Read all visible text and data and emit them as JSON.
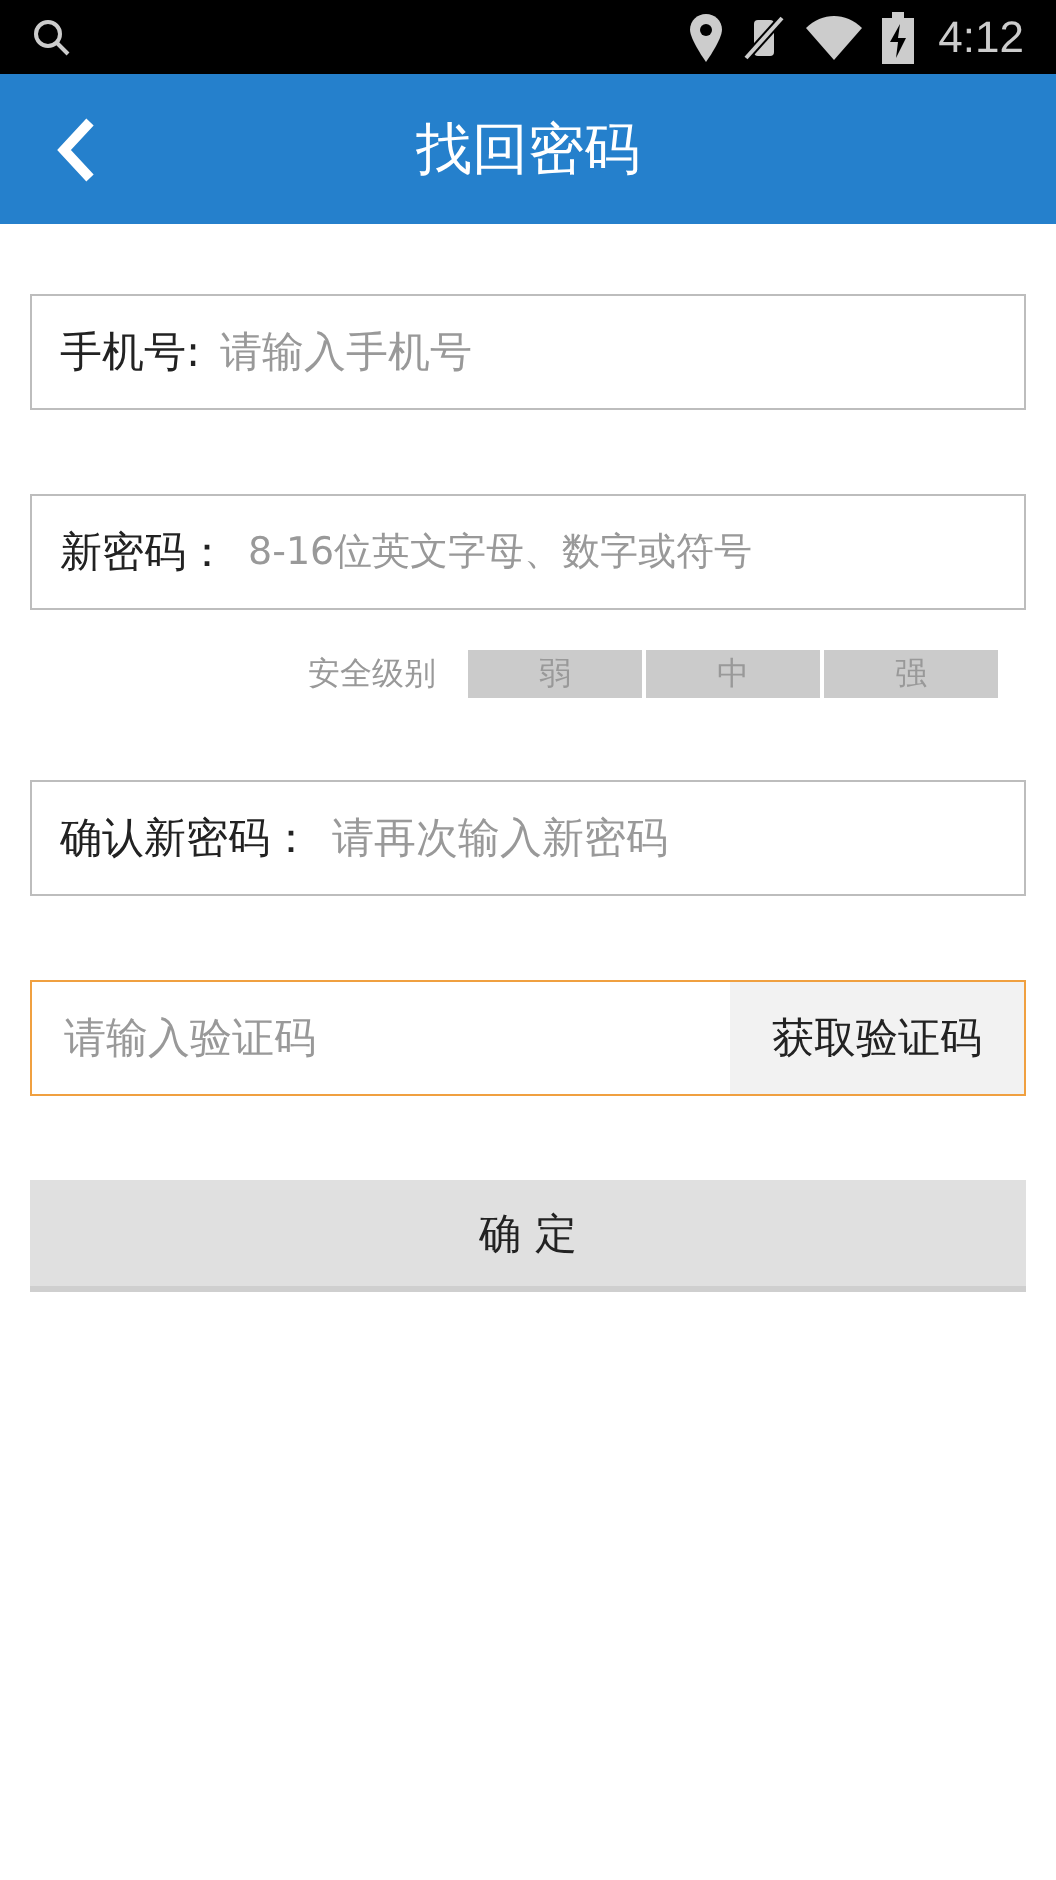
{
  "status_bar": {
    "time": "4:12"
  },
  "header": {
    "title": "找回密码"
  },
  "phone": {
    "label": "手机号:",
    "placeholder": "请输入手机号"
  },
  "new_password": {
    "label": "新密码：",
    "placeholder": "8-16位英文字母、数字或符号"
  },
  "strength": {
    "label": "安全级别",
    "levels": [
      {
        "label": "弱",
        "active": false
      },
      {
        "label": "中",
        "active": false
      },
      {
        "label": "强",
        "active": false
      }
    ]
  },
  "confirm_password": {
    "label": "确认新密码：",
    "placeholder": "请再次输入新密码"
  },
  "verify": {
    "placeholder": "请输入验证码",
    "focused": true,
    "button": "获取验证码"
  },
  "submit": "确 定"
}
